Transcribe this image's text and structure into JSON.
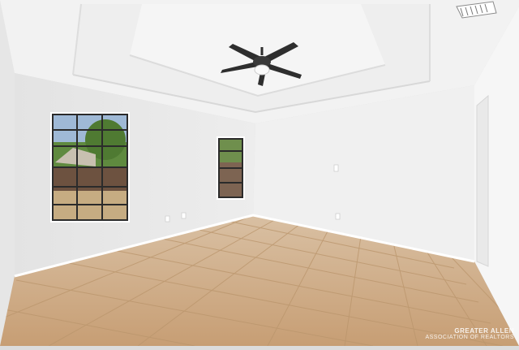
{
  "photo": {
    "subject": "empty-bedroom-interior",
    "colors": {
      "wall_left": "#ececec",
      "wall_back": "#f0f0f0",
      "wall_right": "#f6f6f6",
      "ceiling": "#f3f3f3",
      "floor": "#d2b08a",
      "grout": "#b8946e",
      "fan": "#2e2e2e",
      "window_frame": "#2b2b2b"
    }
  },
  "watermark": {
    "line1": "GREATER ALLEN",
    "line2": "ASSOCIATION OF REALTORS"
  }
}
